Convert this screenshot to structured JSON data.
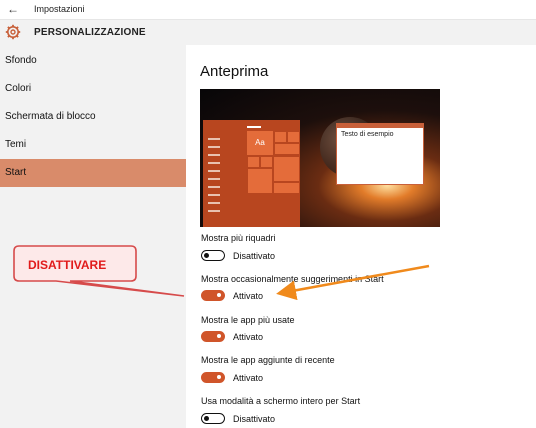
{
  "window": {
    "back_glyph": "←",
    "title": "Impostazioni"
  },
  "header": {
    "icon": "gear-icon",
    "title": "PERSONALIZZAZIONE"
  },
  "sidebar": {
    "items": [
      {
        "label": "Sfondo",
        "active": false
      },
      {
        "label": "Colori",
        "active": false
      },
      {
        "label": "Schermata di blocco",
        "active": false
      },
      {
        "label": "Temi",
        "active": false
      },
      {
        "label": "Start",
        "active": true
      }
    ]
  },
  "main": {
    "heading": "Anteprima",
    "preview": {
      "tile_text": "Aa",
      "window_title": "Testo di esempio"
    },
    "settings": [
      {
        "label": "Mostra più riquadri",
        "state_label": "Disattivato",
        "on": false
      },
      {
        "label": "Mostra occasionalmente suggerimenti in Start",
        "state_label": "Attivato",
        "on": true
      },
      {
        "label": "Mostra le app più usate",
        "state_label": "Attivato",
        "on": true
      },
      {
        "label": "Mostra le app aggiunte di recente",
        "state_label": "Attivato",
        "on": true
      },
      {
        "label": "Usa modalità a schermo intero per Start",
        "state_label": "Disattivato",
        "on": false
      }
    ]
  },
  "annotation": {
    "text": "DISATTIVARE"
  },
  "colors": {
    "accent": "#d0552a",
    "sidebar_active": "#d98b6a",
    "annotation_red": "#e11b1b",
    "arrow_orange": "#f08a1c"
  }
}
